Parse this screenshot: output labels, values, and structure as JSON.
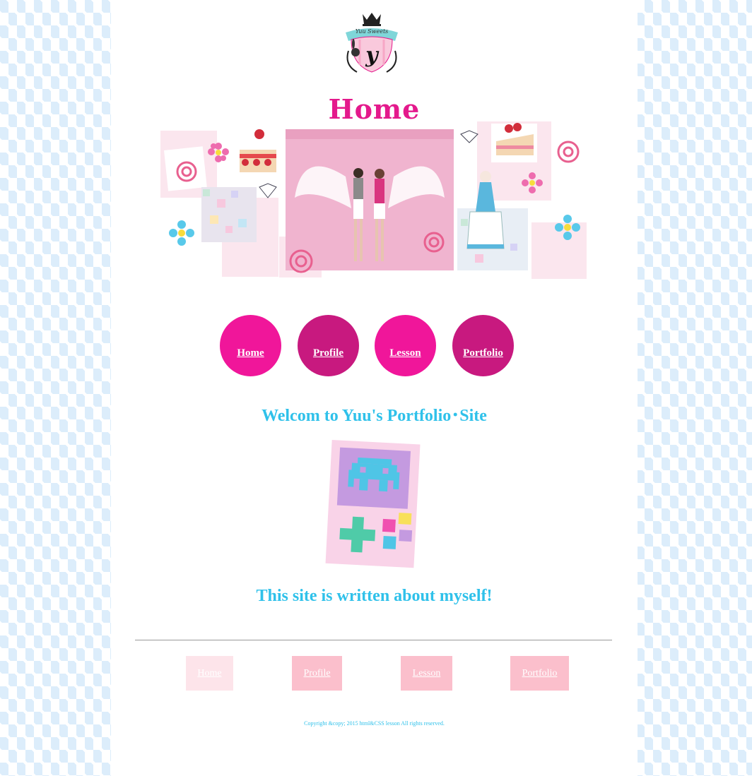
{
  "site": {
    "page_heading": "Home",
    "welcome_text": "Welcom to Yuu's Portfolio･Site",
    "tagline": "This site is written about myself!",
    "copyright": "Copyright &copy; 2015 html&CSS lesson All rights reserved."
  },
  "logo": {
    "icon": "crest-logo-icon",
    "text": "Yuu Sweets",
    "letter": "y"
  },
  "nav_circles": [
    {
      "label": "Home",
      "color": "#f0169a"
    },
    {
      "label": "Profile",
      "color": "#c8197f"
    },
    {
      "label": "Lesson",
      "color": "#f0169a"
    },
    {
      "label": "Portfolio",
      "color": "#c8197f"
    }
  ],
  "footer_nav": [
    {
      "label": "Home",
      "color": "#fde4ea"
    },
    {
      "label": "Profile",
      "color": "#fbbfcc"
    },
    {
      "label": "Lesson",
      "color": "#fbbfcc"
    },
    {
      "label": "Portfolio",
      "color": "#fbbfcc"
    }
  ],
  "colors": {
    "accent_pink": "#e4198c",
    "accent_blue": "#2fc1ea",
    "pattern_blue": "#dcedfb"
  }
}
